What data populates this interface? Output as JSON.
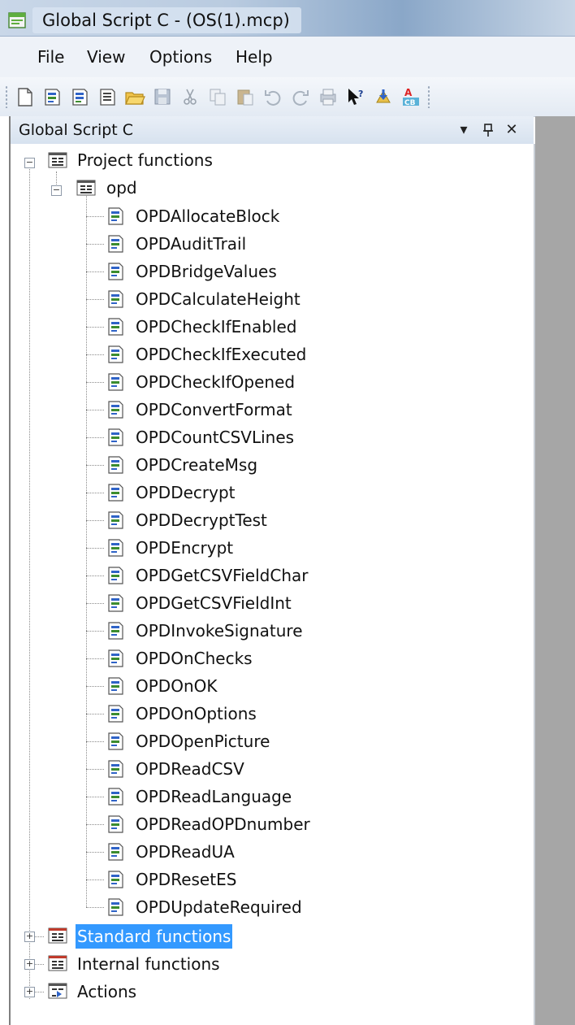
{
  "window": {
    "title": "Global Script C - (OS(1).mcp)"
  },
  "menu": {
    "items": [
      "File",
      "View",
      "Options",
      "Help"
    ]
  },
  "toolbar": {
    "icons": [
      "new-icon",
      "new-function-icon",
      "new-action-icon",
      "new-header-icon",
      "open-folder-icon",
      "save-icon",
      "cut-icon",
      "copy-icon",
      "paste-icon",
      "undo-icon",
      "redo-icon",
      "print-icon",
      "help-pointer-icon",
      "compile-icon",
      "font-color-icon"
    ]
  },
  "pane": {
    "title": "Global Script C",
    "dropdown_glyph": "▾",
    "pin_glyph": "ᵖ",
    "close_glyph": "✕"
  },
  "tree": {
    "project_functions": "Project functions",
    "opd_folder": "opd",
    "functions": [
      "OPDAllocateBlock",
      "OPDAuditTrail",
      "OPDBridgeValues",
      "OPDCalculateHeight",
      "OPDCheckIfEnabled",
      "OPDCheckIfExecuted",
      "OPDCheckIfOpened",
      "OPDConvertFormat",
      "OPDCountCSVLines",
      "OPDCreateMsg",
      "OPDDecrypt",
      "OPDDecryptTest",
      "OPDEncrypt",
      "OPDGetCSVFieldChar",
      "OPDGetCSVFieldInt",
      "OPDInvokeSignature",
      "OPDOnChecks",
      "OPDOnOK",
      "OPDOnOptions",
      "OPDOpenPicture",
      "OPDReadCSV",
      "OPDReadLanguage",
      "OPDReadOPDnumber",
      "OPDReadUA",
      "OPDResetES",
      "OPDUpdateRequired"
    ],
    "standard_functions": "Standard functions",
    "internal_functions": "Internal functions",
    "actions": "Actions",
    "collapse_glyph": "−",
    "expand_glyph": "+"
  },
  "colors": {
    "selection": "#3399ff",
    "accent_title": "#b9cbe0"
  }
}
